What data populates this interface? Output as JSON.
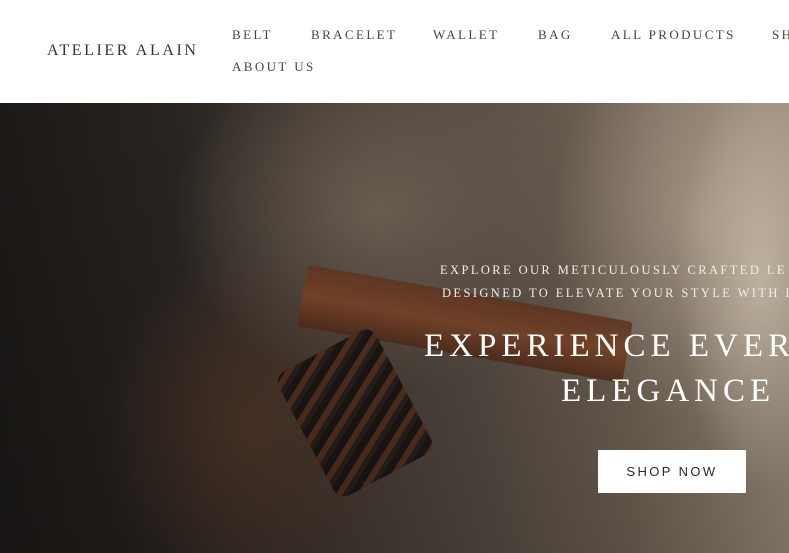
{
  "brand": {
    "name": "ATELIER ALAIN"
  },
  "nav": {
    "items": [
      {
        "label": "BELT"
      },
      {
        "label": "BRACELET"
      },
      {
        "label": "WALLET"
      },
      {
        "label": "BAG"
      },
      {
        "label": "ALL PRODUCTS"
      },
      {
        "label": "SH"
      },
      {
        "label": "ABOUT US"
      }
    ]
  },
  "hero": {
    "tagline_lines": [
      "EXPLORE OUR METICULOUSLY CRAFTED LE",
      "DESIGNED TO ELEVATE YOUR STYLE WITH I"
    ],
    "headline_lines": [
      "EXPERIENCE EVER",
      "ELEGANCE"
    ],
    "cta_label": "SHOP NOW"
  }
}
